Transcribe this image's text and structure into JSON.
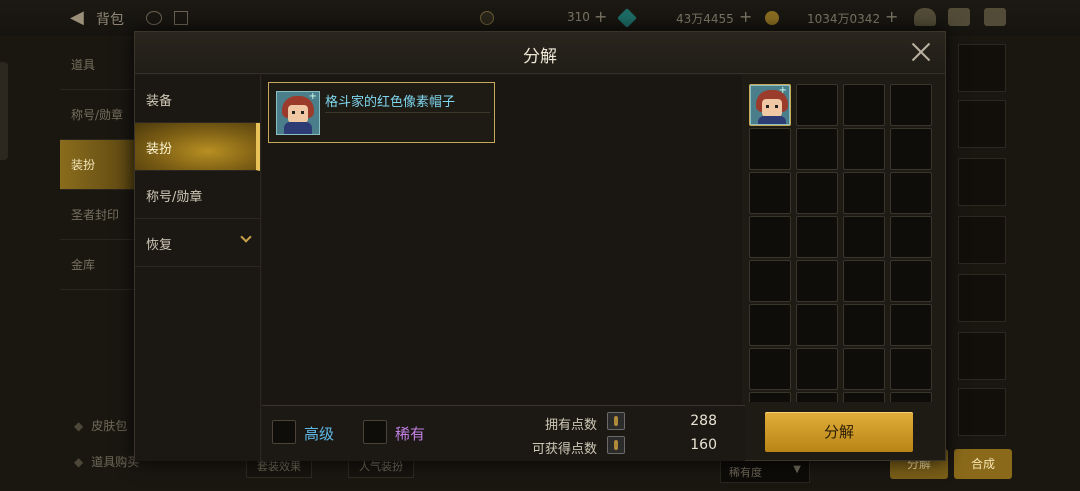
{
  "background": {
    "title": "背包",
    "currencies": [
      {
        "value": "310",
        "icon": "crescent-icon",
        "color": "#8a7a3c"
      },
      {
        "value": "43万4455",
        "icon": "gem-icon",
        "color": "#2aa79a"
      },
      {
        "value": "1034万0342",
        "icon": "gold-coin-icon",
        "color": "#c49a2d"
      }
    ],
    "sidebar": [
      "道具",
      "称号/勋章",
      "装扮",
      "圣者封印",
      "金库"
    ],
    "sidebar_active": 2,
    "bottom_items": [
      "皮肤包",
      "道具购买"
    ],
    "bottom_buttons": [
      "套装效果",
      "人气装扮"
    ],
    "sort_dropdown": "稀有度",
    "right_buttons": [
      "分解",
      "合成"
    ]
  },
  "modal": {
    "title": "分解",
    "categories": [
      {
        "label": "装备",
        "active": false
      },
      {
        "label": "装扮",
        "active": true
      },
      {
        "label": "称号/勋章",
        "active": false
      },
      {
        "label": "恢复",
        "active": false,
        "expandable": true
      }
    ],
    "items": [
      {
        "name": "格斗家的红色像素帽子",
        "icon": "pixel-hat-avatar-icon"
      }
    ],
    "filters": {
      "advanced_label": "高级",
      "advanced_color": "#5fb9e6",
      "rare_label": "稀有",
      "rare_color": "#c07ee0"
    },
    "points": {
      "owned_label": "拥有点数",
      "owned_value": "288",
      "obtain_label": "可获得点数",
      "obtain_value": "160"
    },
    "decompose_button": "分解",
    "selected_slots": 1
  }
}
